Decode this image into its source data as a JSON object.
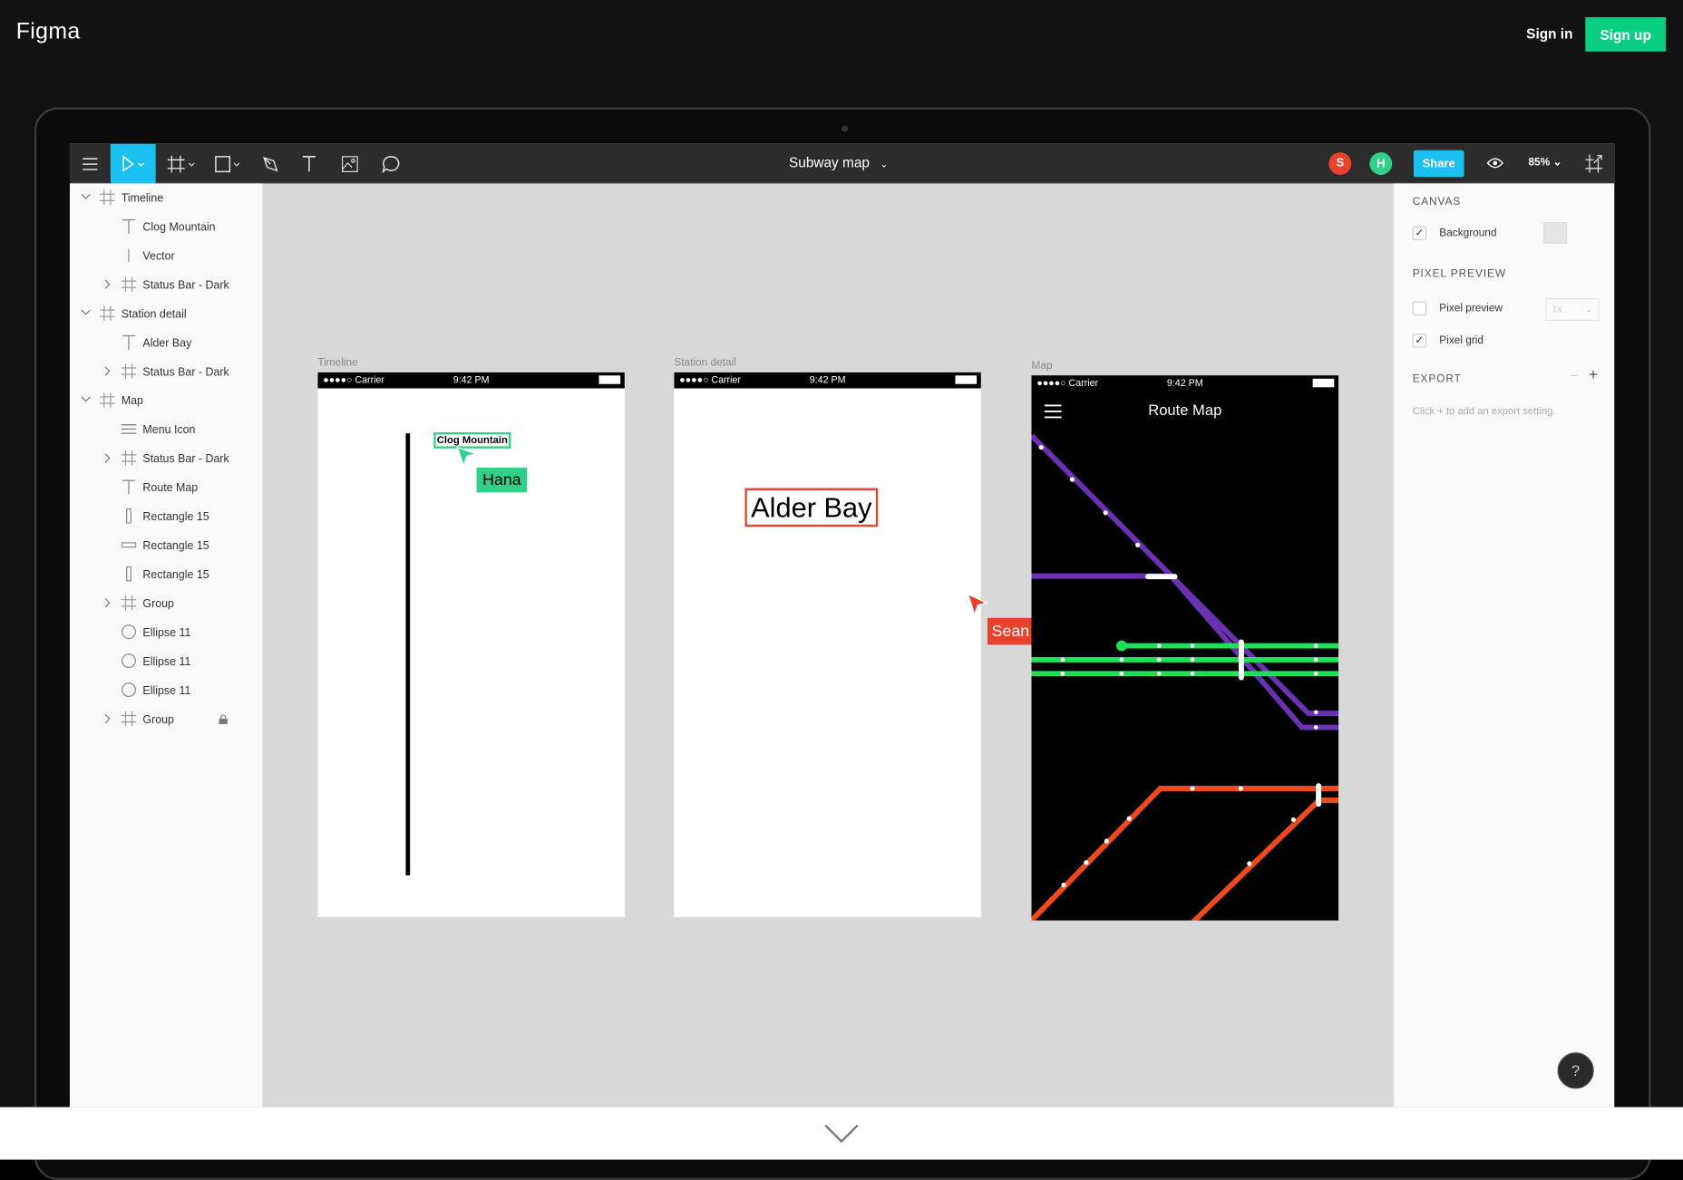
{
  "site": {
    "logo": "Figma",
    "sign_in": "Sign in",
    "sign_up": "Sign up",
    "brand_color": "#0acf83"
  },
  "toolbar": {
    "file_title": "Subway map",
    "share": "Share",
    "zoom": "85%",
    "accent": "#1bc0f0",
    "collaborators": [
      {
        "initial": "S",
        "color": "#e8412c"
      },
      {
        "initial": "H",
        "color": "#2fd087"
      }
    ],
    "tools": [
      "menu-icon",
      "move-tool-icon",
      "frame-tool-icon",
      "rectangle-tool-icon",
      "pen-tool-icon",
      "text-tool-icon",
      "image-tool-icon",
      "comment-tool-icon"
    ]
  },
  "layers": [
    {
      "label": "Timeline",
      "type": "frame",
      "depth": 0,
      "expanded": true
    },
    {
      "label": "Clog Mountain",
      "type": "text",
      "depth": 1
    },
    {
      "label": "Vector",
      "type": "vector",
      "depth": 1
    },
    {
      "label": "Status Bar - Dark",
      "type": "frame",
      "depth": 1,
      "expanded": false
    },
    {
      "label": "Station detail",
      "type": "frame",
      "depth": 0,
      "expanded": true
    },
    {
      "label": "Alder Bay",
      "type": "text",
      "depth": 1
    },
    {
      "label": "Status Bar - Dark",
      "type": "frame",
      "depth": 1,
      "expanded": false
    },
    {
      "label": "Map",
      "type": "frame",
      "depth": 0,
      "expanded": true
    },
    {
      "label": "Menu Icon",
      "type": "menu",
      "depth": 1
    },
    {
      "label": "Status Bar - Dark",
      "type": "frame",
      "depth": 1,
      "expanded": false
    },
    {
      "label": "Route Map",
      "type": "text",
      "depth": 1
    },
    {
      "label": "Rectangle 15",
      "type": "rect-v",
      "depth": 1
    },
    {
      "label": "Rectangle 15",
      "type": "rect-h",
      "depth": 1
    },
    {
      "label": "Rectangle 15",
      "type": "rect-v",
      "depth": 1
    },
    {
      "label": "Group",
      "type": "frame",
      "depth": 1,
      "expanded": false
    },
    {
      "label": "Ellipse 11",
      "type": "ellipse",
      "depth": 1
    },
    {
      "label": "Ellipse 11",
      "type": "ellipse",
      "depth": 1
    },
    {
      "label": "Ellipse 11",
      "type": "ellipse",
      "depth": 1
    },
    {
      "label": "Group",
      "type": "frame",
      "depth": 1,
      "expanded": false,
      "locked": true
    }
  ],
  "canvas": {
    "frames": [
      {
        "label": "Timeline"
      },
      {
        "label": "Station detail"
      },
      {
        "label": "Map"
      }
    ],
    "status_bar": {
      "carrier": "●●●●○ Carrier",
      "time": "9:42 PM"
    },
    "timeline_text": "Clog Mountain",
    "station_text": "Alder Bay",
    "map_title": "Route Map",
    "cursors": [
      {
        "name": "Hana",
        "color": "#2fd087"
      },
      {
        "name": "Sean",
        "color": "#e8412c"
      }
    ],
    "line_colors": {
      "purple": "#6a32b0",
      "green": "#22e055",
      "red": "#ef4a1e"
    }
  },
  "properties": {
    "canvas_heading": "CANVAS",
    "background_label": "Background",
    "background_checked": true,
    "pixel_preview_heading": "PIXEL PREVIEW",
    "pixel_preview_label": "Pixel preview",
    "pixel_preview_checked": false,
    "pixel_preview_scale": "1x",
    "pixel_grid_label": "Pixel grid",
    "pixel_grid_checked": true,
    "export_heading": "EXPORT",
    "export_hint": "Click + to add an export setting."
  },
  "help": "?"
}
